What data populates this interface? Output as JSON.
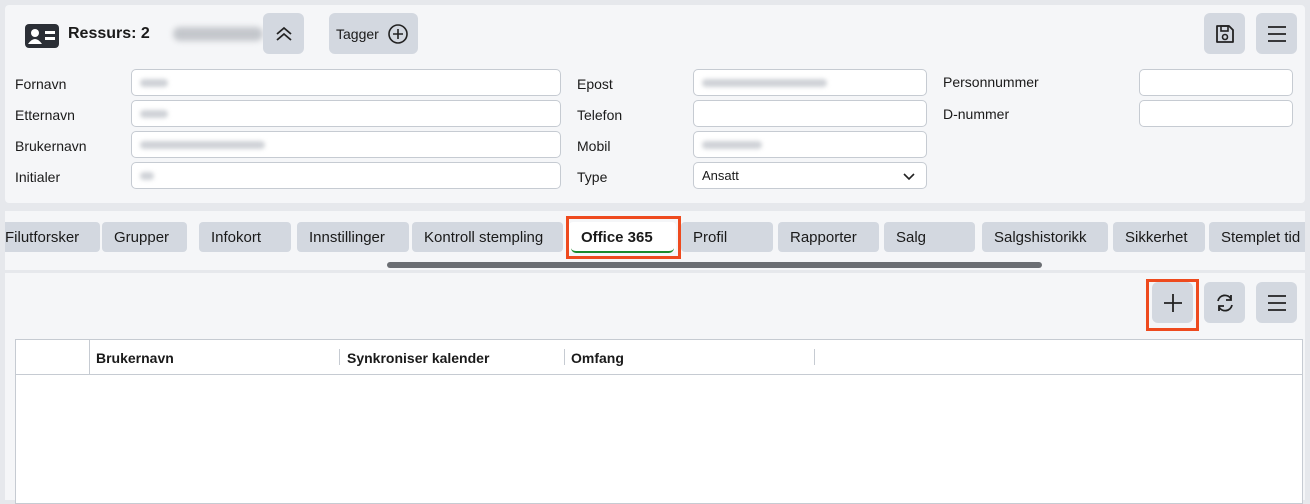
{
  "header": {
    "title": "Ressurs: 2",
    "icon": "id-card-icon",
    "collapse_icon": "chevron-double-up-icon",
    "tags_label": "Tagger",
    "tags_add_icon": "plus-circle-icon",
    "save_icon": "save-icon",
    "menu_icon": "hamburger-menu-icon"
  },
  "form": {
    "fornavn": {
      "label": "Fornavn",
      "value": ""
    },
    "etternavn": {
      "label": "Etternavn",
      "value": ""
    },
    "brukernavn": {
      "label": "Brukernavn",
      "value": ""
    },
    "initialer": {
      "label": "Initialer",
      "value": ""
    },
    "epost": {
      "label": "Epost",
      "value": ""
    },
    "telefon": {
      "label": "Telefon",
      "value": ""
    },
    "mobil": {
      "label": "Mobil",
      "value": ""
    },
    "type": {
      "label": "Type",
      "value": "Ansatt"
    },
    "personnummer": {
      "label": "Personnummer",
      "value": ""
    },
    "dnummer": {
      "label": "D-nummer",
      "value": ""
    }
  },
  "tabs": [
    {
      "label": "Filutforsker"
    },
    {
      "label": "Grupper"
    },
    {
      "label": "Infokort"
    },
    {
      "label": "Innstillinger"
    },
    {
      "label": "Kontroll stempling"
    },
    {
      "label": "Office 365",
      "active": true
    },
    {
      "label": "Profil"
    },
    {
      "label": "Rapporter"
    },
    {
      "label": "Salg"
    },
    {
      "label": "Salgshistorikk"
    },
    {
      "label": "Sikkerhet"
    },
    {
      "label": "Stemplet tid"
    }
  ],
  "grid": {
    "toolbar": {
      "add_icon": "plus-icon",
      "refresh_icon": "refresh-icon",
      "menu_icon": "hamburger-menu-icon"
    },
    "columns": [
      "Brukernavn",
      "Synkroniser kalender",
      "Omfang"
    ],
    "rows": []
  },
  "colors": {
    "highlight": "#ee4a1e",
    "active_tab_underline": "#1b8a2e",
    "button_bg": "#d3d8e0"
  }
}
